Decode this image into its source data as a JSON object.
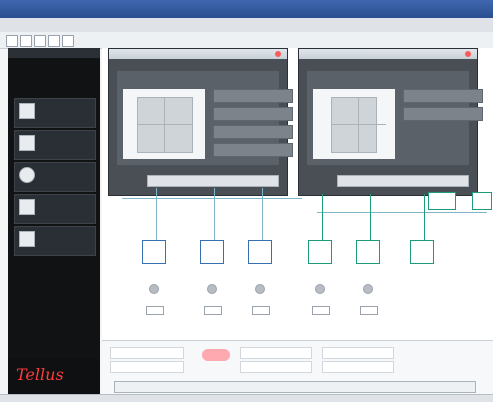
{
  "window": {
    "title": "",
    "menu": [
      "",
      "",
      "",
      "",
      ""
    ]
  },
  "sidebar": {
    "top_items": [
      {
        "label": "",
        "active": true
      },
      {
        "label": ""
      },
      {
        "label": ""
      }
    ],
    "cards": [
      {
        "title": ""
      },
      {
        "title": ""
      },
      {
        "title": ""
      },
      {
        "title": ""
      },
      {
        "title": ""
      }
    ],
    "bottom_items": [
      {
        "label": ""
      },
      {
        "label": ""
      },
      {
        "label": ""
      },
      {
        "label": ""
      },
      {
        "label": ""
      }
    ],
    "logo": "Tellus"
  },
  "panels": [
    {
      "title": "",
      "rows": [
        "",
        "",
        "",
        ""
      ]
    },
    {
      "title": "",
      "rows": [
        "",
        ""
      ]
    }
  ],
  "diagram": {
    "nodes_left": [
      "",
      "",
      ""
    ],
    "nodes_right": [
      "",
      "",
      ""
    ]
  },
  "bottom": {
    "fields": [
      "",
      "",
      "",
      "",
      "",
      ""
    ]
  },
  "colors": {
    "accent_red": "#ff3b3b",
    "line_blue": "#3a6fb3",
    "line_green": "#1d9b7a",
    "sidebar_bg": "#101214"
  }
}
